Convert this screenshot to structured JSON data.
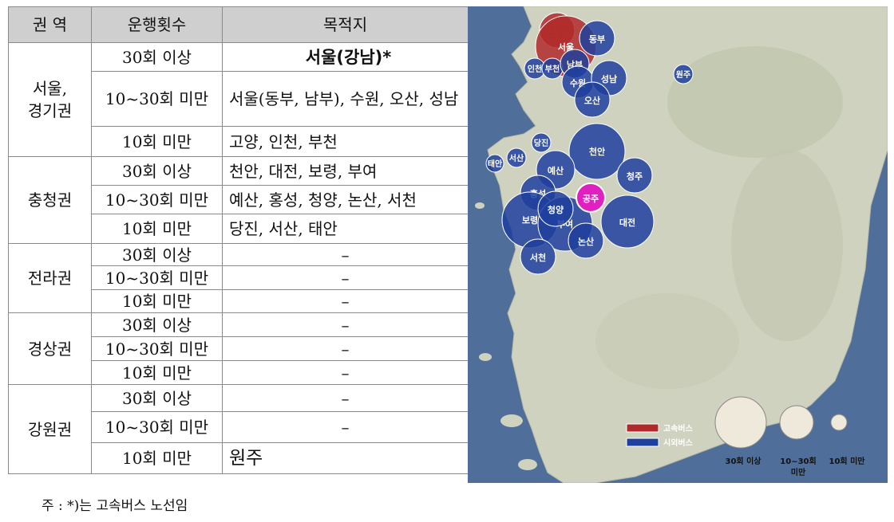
{
  "table": {
    "headers": [
      "권  역",
      "운행횟수",
      "목적지"
    ],
    "regions": [
      {
        "name": "서울,\n경기권",
        "rows": [
          {
            "freq": "30회 이상",
            "dest": "서울(강남)*"
          },
          {
            "freq": "10~30회 미만",
            "dest": "서울(동부, 남부), 수원, 오산, 성남"
          },
          {
            "freq": "10회 미만",
            "dest": "고양, 인천, 부천"
          }
        ]
      },
      {
        "name": "충청권",
        "rows": [
          {
            "freq": "30회 이상",
            "dest": "천안, 대전, 보령, 부여"
          },
          {
            "freq": "10~30회 미만",
            "dest": "예산, 홍성, 청양, 논산, 서천"
          },
          {
            "freq": "10회 미만",
            "dest": "당진, 서산, 태안"
          }
        ]
      },
      {
        "name": "전라권",
        "rows": [
          {
            "freq": "30회 이상",
            "dest": "–"
          },
          {
            "freq": "10~30회 미만",
            "dest": "–"
          },
          {
            "freq": "10회 미만",
            "dest": "–"
          }
        ]
      },
      {
        "name": "경상권",
        "rows": [
          {
            "freq": "30회 이상",
            "dest": "–"
          },
          {
            "freq": "10~30회 미만",
            "dest": "–"
          },
          {
            "freq": "10회 미만",
            "dest": "–"
          }
        ]
      },
      {
        "name": "강원권",
        "rows": [
          {
            "freq": "30회 이상",
            "dest": "–"
          },
          {
            "freq": "10~30회 미만",
            "dest": "–"
          },
          {
            "freq": "10회 미만",
            "dest": "원주"
          }
        ]
      }
    ]
  },
  "note": "주 : *)는 고속버스 노선임",
  "map": {
    "cities": [
      "고양",
      "서울",
      "동부",
      "인천",
      "부천",
      "남부",
      "수원",
      "성남",
      "오산",
      "원주",
      "당진",
      "서산",
      "태안",
      "천안",
      "예산",
      "청주",
      "홍성",
      "공주",
      "청양",
      "보령",
      "부여",
      "대전",
      "논산",
      "서천"
    ],
    "legend": {
      "express": "고속버스",
      "intercity": "시외버스",
      "size_30": "30회 이상",
      "size_10_30_line1": "10~30회",
      "size_10_30_line2": "미만",
      "size_10": "10회 미만"
    },
    "colors": {
      "express": "#b02a2a",
      "intercity": "#1f3f9e",
      "origin": "#e020c0",
      "legend_size": "#efe9dc"
    }
  }
}
